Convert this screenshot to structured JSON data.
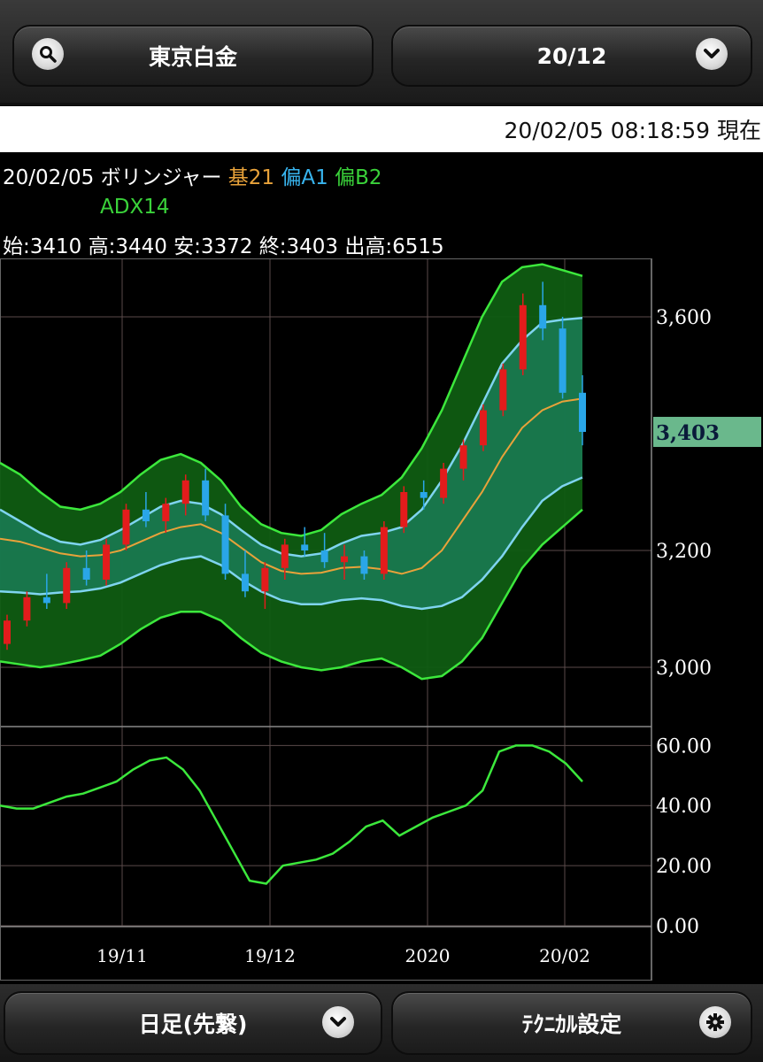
{
  "header": {
    "instrument": "東京白金",
    "contract": "20/12",
    "search_icon": "search-icon",
    "dropdown_icon": "chevron-down-icon"
  },
  "timestamp": "20/02/05 08:18:59 現在",
  "info": {
    "date": "20/02/05",
    "indicator": "ボリンジャー",
    "base": "基21",
    "dev_a": "偏A1",
    "dev_b": "偏B2",
    "adx": "ADX14",
    "ohlc": "始:3410 高:3440 安:3372 終:3403 出高:6515"
  },
  "footer": {
    "period": "日足(先繋)",
    "technical": "ﾃｸﾆｶﾙ設定",
    "settings_icon": "gear-icon"
  },
  "colors": {
    "up": "#e31c1c",
    "down": "#2aa6e8",
    "mid_band": "#e8a23a",
    "band1": "#7fd4f0",
    "band2": "#3ce83c",
    "adx": "#3ce83c",
    "last_price_bg": "#6ab88c"
  },
  "chart_data": {
    "type": "candlestick",
    "price_axis": {
      "ticks": [
        "3,600",
        "3,200",
        "3,000"
      ],
      "tick_values": [
        3600,
        3200,
        3000
      ],
      "ylim": [
        2900,
        3700
      ]
    },
    "last_price": "3,403",
    "last_price_value": 3403,
    "x_ticks": [
      "19/11",
      "19/12",
      "2020",
      "20/02"
    ],
    "adx_axis": {
      "ticks": [
        "60.00",
        "40.00",
        "20.00",
        "0.00"
      ],
      "tick_values": [
        60,
        40,
        20,
        0
      ],
      "ylim": [
        0,
        66
      ]
    },
    "mid": [
      3220,
      3215,
      3205,
      3195,
      3190,
      3192,
      3200,
      3215,
      3230,
      3240,
      3245,
      3230,
      3205,
      3180,
      3165,
      3160,
      3162,
      3170,
      3172,
      3168,
      3160,
      3170,
      3200,
      3250,
      3300,
      3360,
      3410,
      3440,
      3455,
      3460
    ],
    "upper1": [
      3270,
      3250,
      3230,
      3215,
      3210,
      3218,
      3235,
      3255,
      3275,
      3285,
      3280,
      3262,
      3235,
      3210,
      3195,
      3190,
      3195,
      3212,
      3225,
      3230,
      3240,
      3270,
      3320,
      3380,
      3450,
      3520,
      3560,
      3590,
      3595,
      3598
    ],
    "lower1": [
      3130,
      3128,
      3125,
      3128,
      3130,
      3135,
      3145,
      3160,
      3175,
      3185,
      3190,
      3175,
      3150,
      3130,
      3115,
      3108,
      3108,
      3115,
      3118,
      3115,
      3105,
      3100,
      3105,
      3120,
      3150,
      3190,
      3240,
      3285,
      3310,
      3325
    ],
    "upper2": [
      3350,
      3330,
      3300,
      3275,
      3270,
      3280,
      3300,
      3330,
      3355,
      3365,
      3350,
      3320,
      3275,
      3245,
      3230,
      3225,
      3235,
      3262,
      3280,
      3295,
      3325,
      3375,
      3440,
      3520,
      3600,
      3660,
      3685,
      3690,
      3680,
      3670
    ],
    "lower2": [
      3010,
      3005,
      3000,
      3005,
      3012,
      3020,
      3040,
      3065,
      3085,
      3095,
      3095,
      3080,
      3050,
      3025,
      3010,
      3000,
      2995,
      3000,
      3010,
      3015,
      3000,
      2980,
      2985,
      3010,
      3050,
      3110,
      3170,
      3210,
      3240,
      3270
    ],
    "candles": [
      [
        3040,
        3090,
        3030,
        3080
      ],
      [
        3080,
        3130,
        3070,
        3120
      ],
      [
        3120,
        3160,
        3100,
        3110
      ],
      [
        3110,
        3180,
        3100,
        3170
      ],
      [
        3170,
        3200,
        3140,
        3150
      ],
      [
        3150,
        3220,
        3140,
        3210
      ],
      [
        3210,
        3280,
        3200,
        3270
      ],
      [
        3270,
        3300,
        3240,
        3250
      ],
      [
        3250,
        3290,
        3230,
        3280
      ],
      [
        3280,
        3330,
        3260,
        3320
      ],
      [
        3320,
        3340,
        3250,
        3260
      ],
      [
        3260,
        3280,
        3150,
        3160
      ],
      [
        3160,
        3200,
        3120,
        3130
      ],
      [
        3130,
        3180,
        3100,
        3170
      ],
      [
        3170,
        3220,
        3150,
        3210
      ],
      [
        3210,
        3240,
        3190,
        3200
      ],
      [
        3200,
        3230,
        3170,
        3180
      ],
      [
        3180,
        3210,
        3150,
        3190
      ],
      [
        3190,
        3200,
        3150,
        3160
      ],
      [
        3160,
        3250,
        3150,
        3240
      ],
      [
        3240,
        3310,
        3230,
        3300
      ],
      [
        3300,
        3320,
        3270,
        3290
      ],
      [
        3290,
        3350,
        3280,
        3340
      ],
      [
        3340,
        3390,
        3320,
        3380
      ],
      [
        3380,
        3450,
        3370,
        3440
      ],
      [
        3440,
        3520,
        3430,
        3510
      ],
      [
        3510,
        3640,
        3500,
        3620
      ],
      [
        3620,
        3660,
        3560,
        3580
      ],
      [
        3580,
        3600,
        3460,
        3470
      ],
      [
        3470,
        3500,
        3380,
        3403
      ]
    ],
    "adx": [
      40,
      39,
      39,
      41,
      43,
      44,
      46,
      48,
      52,
      55,
      56,
      52,
      45,
      35,
      25,
      15,
      14,
      20,
      21,
      22,
      24,
      28,
      33,
      35,
      30,
      33,
      36,
      38,
      40,
      45,
      58,
      60,
      60,
      58,
      54,
      48
    ]
  }
}
